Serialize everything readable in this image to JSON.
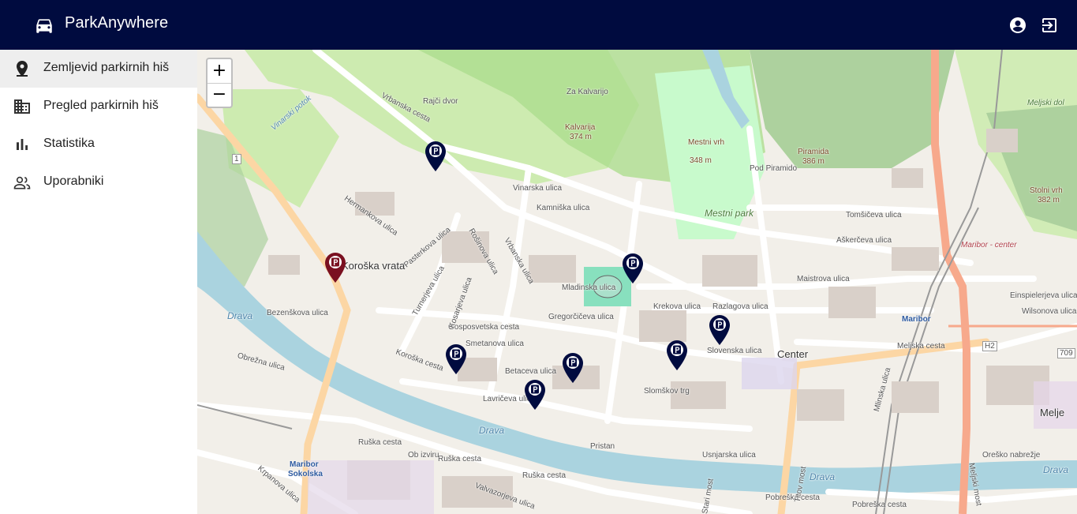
{
  "app": {
    "title": "ParkAnywhere",
    "icon": "car-icon",
    "primary_color": "#000b3f",
    "actions": [
      {
        "name": "account-icon"
      },
      {
        "name": "logout-icon"
      }
    ]
  },
  "sidebar": {
    "items": [
      {
        "label": "Zemljevid parkirnih hiš",
        "icon": "map-marker-icon",
        "active": true
      },
      {
        "label": "Pregled parkirnih hiš",
        "icon": "building-icon",
        "active": false
      },
      {
        "label": "Statistika",
        "icon": "bar-chart-icon",
        "active": false
      },
      {
        "label": "Uporabniki",
        "icon": "people-icon",
        "active": false
      }
    ]
  },
  "map": {
    "zoom_in_label": "+",
    "zoom_out_label": "−",
    "places": {
      "koroska_vrata": "Koroška vrata",
      "center": "Center",
      "mestni_park": "Mestni park",
      "kalvarija": "Kalvarija",
      "kalvarija_elev": "374 m",
      "mestni_vrh": "Mestni vrh",
      "mestni_vrh_elev": "348 m",
      "piramida": "Piramida",
      "piramida_elev": "386 m",
      "stolni_vrh": "Stolni vrh",
      "stolni_vrh_elev": "382 m",
      "meljski_dol": "Meljski dol",
      "melje": "Melje",
      "maribor_station": "Maribor",
      "maribor_center": "Maribor - center",
      "maribor_sokolska_1": "Maribor",
      "maribor_sokolska_2": "Sokolska",
      "drava_1": "Drava",
      "drava_2": "Drava",
      "drava_3": "Drava",
      "drava_4": "Drava",
      "h2": "H2",
      "road_1": "1",
      "road_709": "709"
    },
    "streets": {
      "vrbanska": "Vrbanska cesta",
      "vinarska": "Vinarska ulica",
      "kamniska": "Kamniška ulica",
      "mladinska": "Mladinska ulica",
      "gosposvetska": "Gosposvetska cesta",
      "koroska_cesta": "Koroška cesta",
      "krekova": "Krekova ulica",
      "razlagova": "Razlagova ulica",
      "maistrova": "Maistrova ulica",
      "askerceva": "Aškerčeva ulica",
      "tomsiceva": "Tomšičeva ulica",
      "meljska": "Meljska cesta",
      "smetanova": "Smetanova ulica",
      "belaceva": "Betaceva ulica",
      "lavriceva": "Lavričeva ulica",
      "pristan": "Pristan",
      "ruska_1": "Ruška cesta",
      "ruska_2": "Ruška cesta",
      "ruska_3": "Ruška cesta",
      "obrezna": "Obrežna ulica",
      "usnjarska": "Usnjarska ulica",
      "pobreska_1": "Pobreška cesta",
      "pobreska_2": "Pobreška cesta",
      "orezno": "Oreško nabrežje",
      "gregorciceva": "Gregorčičeva ulica",
      "slomskov": "Slomškov trg",
      "einspielerjeva": "Einspielerjeva ulica",
      "wilsonova": "Wilsonova ulica",
      "pasterkova": "Pasterkova ulica",
      "hermankova": "Hermankova ulica",
      "bezenskova": "Bezenškova ulica",
      "valvazorjeva": "Valvazorjeva ulica",
      "krpanova": "Krpanova ulica",
      "za_kalvarijo": "Za Kalvarijo",
      "radji_dvor": "Rajči dvor",
      "vinarski_potok": "Vinarski potok",
      "pod_piramido": "Pod Piramido",
      "turnerjeva": "Turnerjeva ulica",
      "rosinova": "Rošinova ulica",
      "vrbanska_ul": "Vrbanska ulica",
      "kosarjeva": "Kosarjeva ulica",
      "ob_izviru": "Ob izviru",
      "slovenska": "Slovenska ulica",
      "titova": "Titov most",
      "starimost": "Stari most",
      "meljski_most": "Meljski most",
      "mlinska": "Mlinska ulica"
    },
    "markers": [
      {
        "name": "parking-marker",
        "selected": false,
        "color": "#000b3f"
      },
      {
        "name": "parking-marker",
        "selected": true,
        "color": "#7a1020"
      },
      {
        "name": "parking-marker",
        "selected": false,
        "color": "#000b3f"
      },
      {
        "name": "parking-marker",
        "selected": false,
        "color": "#000b3f"
      },
      {
        "name": "parking-marker",
        "selected": false,
        "color": "#000b3f"
      },
      {
        "name": "parking-marker",
        "selected": false,
        "color": "#000b3f"
      },
      {
        "name": "parking-marker",
        "selected": false,
        "color": "#000b3f"
      },
      {
        "name": "parking-marker",
        "selected": false,
        "color": "#000b3f"
      }
    ]
  }
}
